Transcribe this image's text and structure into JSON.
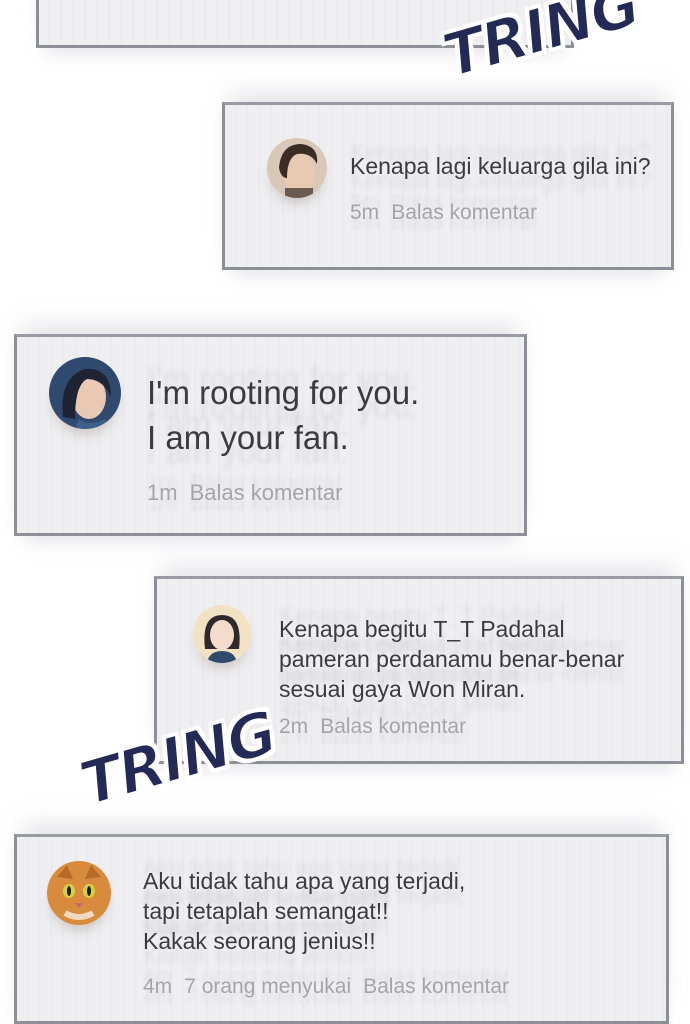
{
  "comments": [
    {
      "text_lines": [
        "Kenapa lagi keluarga gila ini?"
      ],
      "time": "5m",
      "likes": "",
      "reply_label": "Balas komentar"
    },
    {
      "text_lines": [
        "I'm rooting for you.",
        "I am your fan."
      ],
      "time": "1m",
      "likes": "",
      "reply_label": "Balas komentar"
    },
    {
      "text_lines": [
        "Kenapa begitu T_T Padahal",
        "pameran perdanamu benar-benar",
        "sesuai gaya Won Miran."
      ],
      "time": "2m",
      "likes": "",
      "reply_label": "Balas komentar"
    },
    {
      "text_lines": [
        "Aku tidak tahu apa yang terjadi,",
        "tapi tetaplah semangat!!",
        "Kakak seorang jenius!!"
      ],
      "time": "4m",
      "likes": "7 orang menyukai",
      "reply_label": "Balas komentar"
    }
  ],
  "sfx": [
    "TRING",
    "TRING"
  ],
  "colors": {
    "card_bg": "#efeff1",
    "card_border": "#8e8e96",
    "sfx": "#232a55",
    "text": "#3a3a40",
    "meta": "#a4a4aa"
  },
  "icons": [
    "man-avatar-icon",
    "woman-avatar-icon",
    "girl-avatar-icon",
    "cat-avatar-icon"
  ]
}
